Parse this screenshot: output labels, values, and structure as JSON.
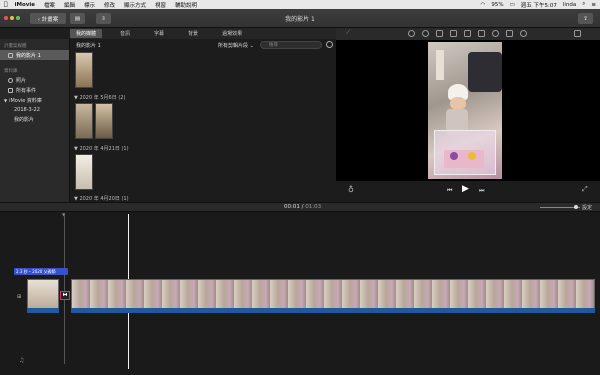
{
  "menubar": {
    "apple": "",
    "app": "iMovie",
    "items": [
      "檔案",
      "編輯",
      "標示",
      "修改",
      "顯示方式",
      "視窗",
      "輔助說明"
    ],
    "battery": "95%",
    "clock": "週五 下午5:07",
    "user": "linda"
  },
  "toolbar": {
    "back_label": "‹ 計畫案",
    "window_title": "我的影片 1"
  },
  "library_tabs": [
    "我的媒體",
    "音訊",
    "字幕",
    "背景",
    "過場效果"
  ],
  "sidebar": {
    "section1": "計畫案媒體",
    "project_item": "我的影片 1",
    "section2": "資料庫",
    "items": [
      "照片",
      "所有事件",
      "iMovie 資料庫",
      "2018-3-22",
      "我的影片"
    ]
  },
  "browser": {
    "title": "我的影片 1",
    "filter": "所有剪輯片段 ⌄",
    "search_placeholder": "搜尋",
    "dates": [
      {
        "label": "2020 年 5月6日",
        "count": "(2)"
      },
      {
        "label": "2020 年 4月21日",
        "count": "(1)"
      },
      {
        "label": "2020 年 4月20日",
        "count": "(1)"
      }
    ]
  },
  "timeline": {
    "current": "00:01",
    "separator": "/",
    "total": "01:03",
    "settings": "設定",
    "clip_title": "2.3 秒 – 2020 父親節"
  },
  "colors": {
    "accent": "#3a7bd5",
    "audio": "#1f5a9e",
    "highlight": "#e0306a"
  }
}
